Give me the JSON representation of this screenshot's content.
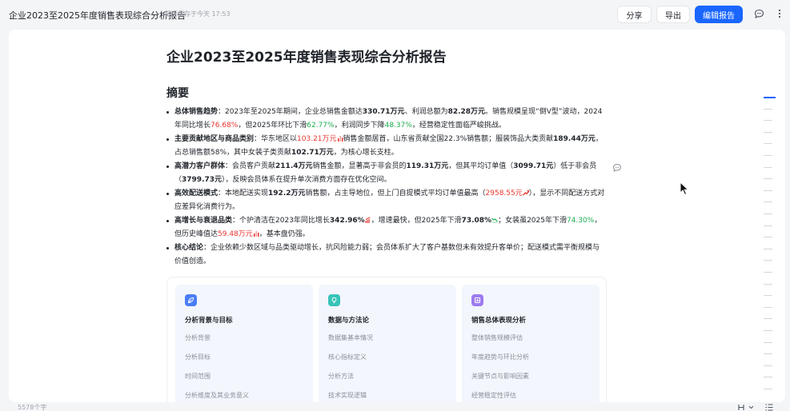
{
  "topbar": {
    "doc_title": "企业2023至2025年度销售表现综合分析报告",
    "save_status": "最近保存于今天 17:53",
    "share_label": "分享",
    "export_label": "导出",
    "edit_label": "编辑报告"
  },
  "doc": {
    "title": "企业2023至2025年度销售表现综合分析报告",
    "summary_heading": "摘要",
    "bullets": [
      {
        "label": "总体销售趋势",
        "p1": "：2023年至2025年期间，企业总销售金额达",
        "v1": "330.71万元",
        "p2": "、利润总额为",
        "v2": "82.28万元",
        "p3": "。销售规模呈现“倒V型”波动，2024年同比增长",
        "v3": "76.68%",
        "p4": "，但2025年环比下滑",
        "v4": "62.77%",
        "p5": "，利润同步下降",
        "v5": "48.37%",
        "p6": "，经营稳定性面临严峻挑战。"
      },
      {
        "label": "主要贡献地区与商品类别",
        "p1": "：华东地区以",
        "v1": "103.21万元",
        "p2": "销售金额居首，山东省贡献全国22.3%销售额；服装饰品大类贡献",
        "v2": "189.44万元",
        "p3": "，占总销售额58%，其中女装子类贡献",
        "v3": "102.71万元",
        "p4": "，为核心增长支柱。"
      },
      {
        "label": "高潜力客户群体",
        "p1": "：会员客户贡献",
        "v1": "211.4万元",
        "p2": "销售金额，显著高于非会员的",
        "v2": "119.31万元",
        "p3": "，但其平均订单值（",
        "v3": "3099.71元",
        "p4": "）低于非会员（",
        "v4": "3799.73元",
        "p5": "），反映会员体系在提升单次消费方面存在优化空间。"
      },
      {
        "label": "高效配送模式",
        "p1": "：本地配送实现",
        "v1": "192.2万元",
        "p2": "销售额，占主导地位，但上门自提模式平均订单值最高（",
        "v2": "2958.55元",
        "p3": "），显示不同配送方式对应差异化消费行为。"
      },
      {
        "label": "高增长与衰退品类",
        "p1": "：个护清洁在2023年同比增长",
        "v1": "342.96%",
        "p2": "，增速最快，但2025年下滑",
        "v2": "73.08%",
        "p3": "；女装虽2025年下滑",
        "v3": "74.30%",
        "p4": "，但历史峰值达",
        "v4": "59.48万元",
        "p5": "，基本盘仍强。"
      },
      {
        "label": "核心结论",
        "p1": "：企业依赖少数区域与品类驱动增长，抗风险能力弱；会员体系扩大了客户基数但未有效提升客单价；配送模式需平衡规模与价值创造。"
      }
    ],
    "cards": [
      {
        "title": "分析背景与目标",
        "icon": "leaf-icon",
        "color": "#4a7ef6",
        "items": [
          "分析背景",
          "分析目标",
          "时间范围",
          "分析维度及其业务意义"
        ]
      },
      {
        "title": "数据与方法论",
        "icon": "bulb-icon",
        "color": "#37c4b8",
        "items": [
          "数据集基本情况",
          "核心指标定义",
          "分析方法",
          "技术实现逻辑"
        ]
      },
      {
        "title": "销售总体表现分析",
        "icon": "chart-icon",
        "color": "#9d7bf0",
        "items": [
          "整体销售规模评估",
          "年度趋势与环比分析",
          "关键节点与影响因素",
          "经营稳定性评估"
        ]
      }
    ]
  },
  "footer": {
    "word_count": "5578个字"
  },
  "colors": {
    "accent": "#1a66ff",
    "increase": "#e8352e",
    "decrease": "#1fae50"
  }
}
